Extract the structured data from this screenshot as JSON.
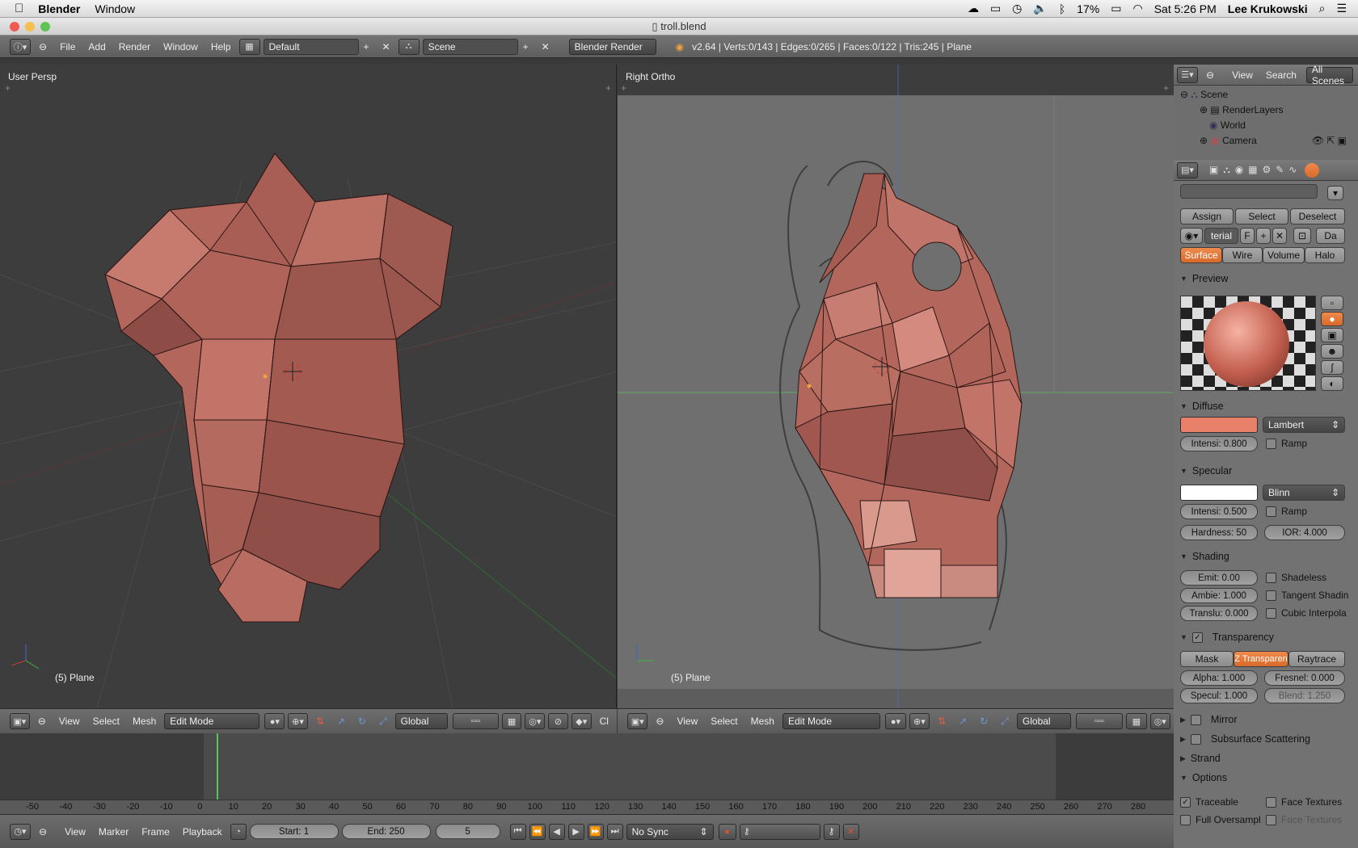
{
  "menubar": {
    "app_name": "Blender",
    "items": [
      "Window"
    ],
    "battery": "17%",
    "clock": "Sat 5:26 PM",
    "user": "Lee Krukowski"
  },
  "window": {
    "title": "troll.blend"
  },
  "info_header": {
    "menus": [
      "File",
      "Add",
      "Render",
      "Window",
      "Help"
    ],
    "screen_layout": "Default",
    "scene": "Scene",
    "render_engine": "Blender Render",
    "stats": "v2.64 | Verts:0/143 | Edges:0/265 | Faces:0/122 | Tris:245 | Plane"
  },
  "viewport_left": {
    "label": "User Persp",
    "object_label": "(5) Plane",
    "menus": [
      "View",
      "Select",
      "Mesh"
    ],
    "mode": "Edit Mode",
    "orientation": "Global",
    "trailing_text": "Cl"
  },
  "viewport_right": {
    "label": "Right Ortho",
    "object_label": "(5) Plane",
    "menus": [
      "View",
      "Select",
      "Mesh"
    ],
    "mode": "Edit Mode",
    "orientation": "Global"
  },
  "outliner": {
    "menus": [
      "View",
      "Search"
    ],
    "filter": "All Scenes",
    "items": [
      "Scene",
      "RenderLayers",
      "World",
      "Camera"
    ]
  },
  "properties": {
    "assign_buttons": [
      "Assign",
      "Select",
      "Deselect"
    ],
    "material_name": "terial",
    "material_f": "F",
    "material_da": "Da",
    "tabs": [
      "Surface",
      "Wire",
      "Volume",
      "Halo"
    ],
    "preview": {
      "title": "Preview"
    },
    "diffuse": {
      "title": "Diffuse",
      "color": "#e8806a",
      "shader": "Lambert",
      "intensity": "Intensi: 0.800",
      "ramp": "Ramp"
    },
    "specular": {
      "title": "Specular",
      "color": "#ffffff",
      "shader": "Blinn",
      "intensity": "Intensi: 0.500",
      "ramp": "Ramp",
      "hardness": "Hardness: 50",
      "ior": "IOR: 4.000"
    },
    "shading": {
      "title": "Shading",
      "emit": "Emit: 0.00",
      "ambient": "Ambie: 1.000",
      "translucency": "Translu: 0.000",
      "shadeless": "Shadeless",
      "tangent": "Tangent Shadin",
      "cubic": "Cubic Interpola"
    },
    "transparency": {
      "title": "Transparency",
      "modes": [
        "Mask",
        "Z Transparen",
        "Raytrace"
      ],
      "alpha": "Alpha: 1.000",
      "fresnel": "Fresnel: 0.000",
      "specular": "Specul: 1.000",
      "blend": "Blend: 1.250"
    },
    "mirror": "Mirror",
    "sss": "Subsurface Scattering",
    "strand": "Strand",
    "options": {
      "title": "Options",
      "traceable": "Traceable",
      "face_textures": "Face Textures",
      "full_oversampling": "Full Oversampl",
      "face_textures_alpha": "Face Textures"
    }
  },
  "timeline": {
    "ruler": [
      "-50",
      "-40",
      "-30",
      "-20",
      "-10",
      "0",
      "10",
      "20",
      "30",
      "40",
      "50",
      "60",
      "70",
      "80",
      "90",
      "100",
      "110",
      "120",
      "130",
      "140",
      "150",
      "160",
      "170",
      "180",
      "190",
      "200",
      "210",
      "220",
      "230",
      "240",
      "250",
      "260",
      "270",
      "280"
    ],
    "current_frame": 5,
    "menus": [
      "View",
      "Marker",
      "Frame",
      "Playback"
    ],
    "start": "Start: 1",
    "end": "End: 250",
    "frame": "5",
    "sync": "No Sync"
  },
  "colors": {
    "mesh_face": "#b3665c",
    "mesh_face_light": "#d48a7e",
    "accent_orange": "#e0742f",
    "viewport_bg": "#3d3d3d",
    "ortho_bg": "#6f6f6f"
  }
}
